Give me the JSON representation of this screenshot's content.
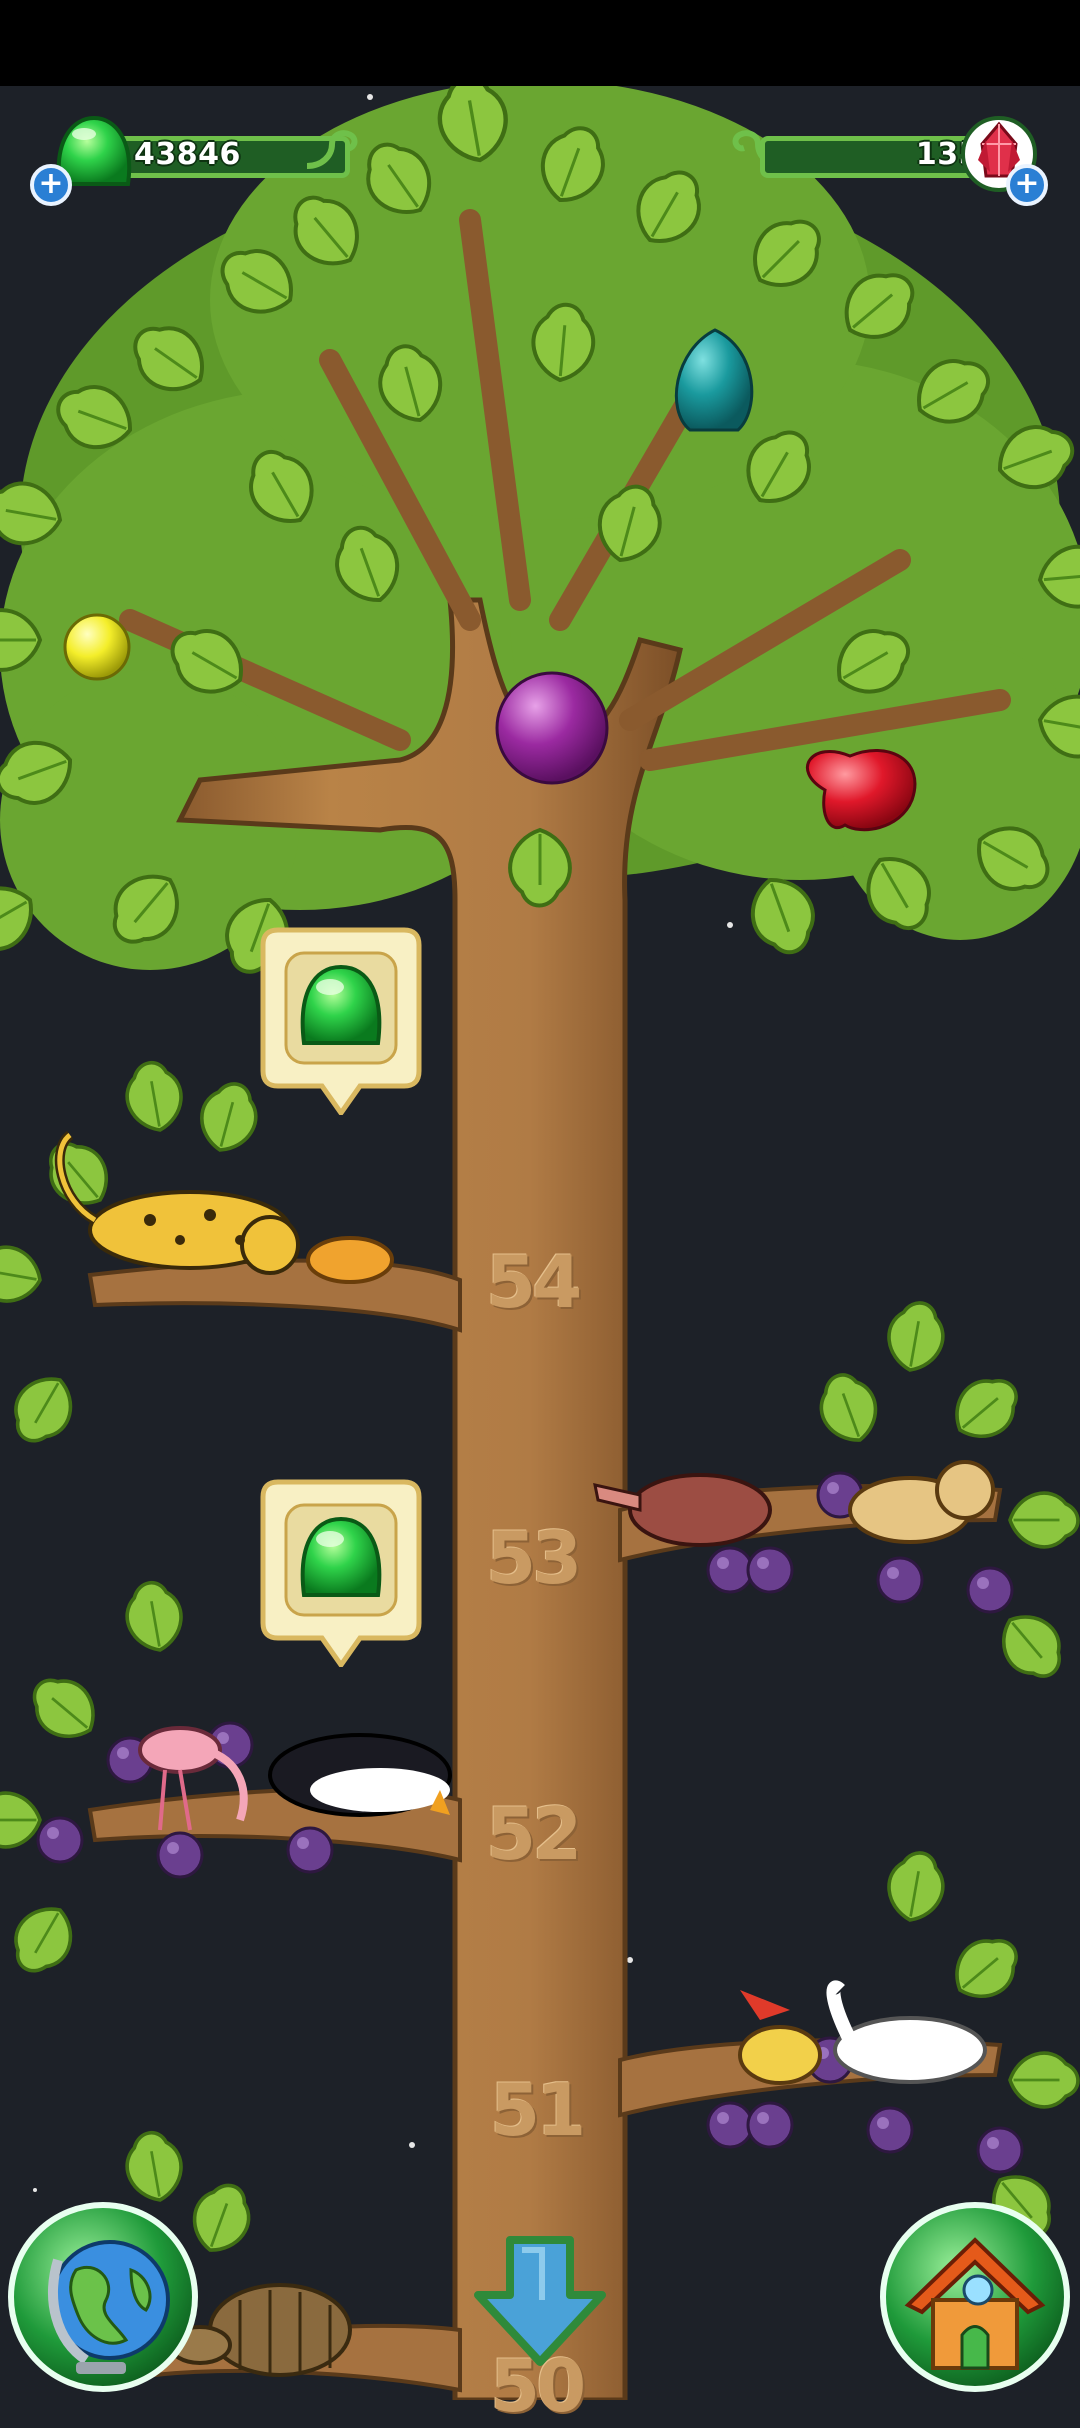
{
  "header": {
    "gems_count": "43846",
    "crystals_count": "135"
  },
  "levels": [
    "54",
    "53",
    "52",
    "51",
    "50"
  ],
  "icons": {
    "gem": "green-jelly-gem-icon",
    "crystal": "red-crystal-icon",
    "plus": "plus-icon",
    "map": "globe-icon",
    "home": "house-icon",
    "scroll": "down-arrow-icon"
  },
  "plus_symbol": "+",
  "colors": {
    "background": "#1d2128",
    "trunk": "#b07b45",
    "leaves": "#8cc63f",
    "bar_fill": "#1f5e24",
    "bar_border": "#6fc04a"
  }
}
